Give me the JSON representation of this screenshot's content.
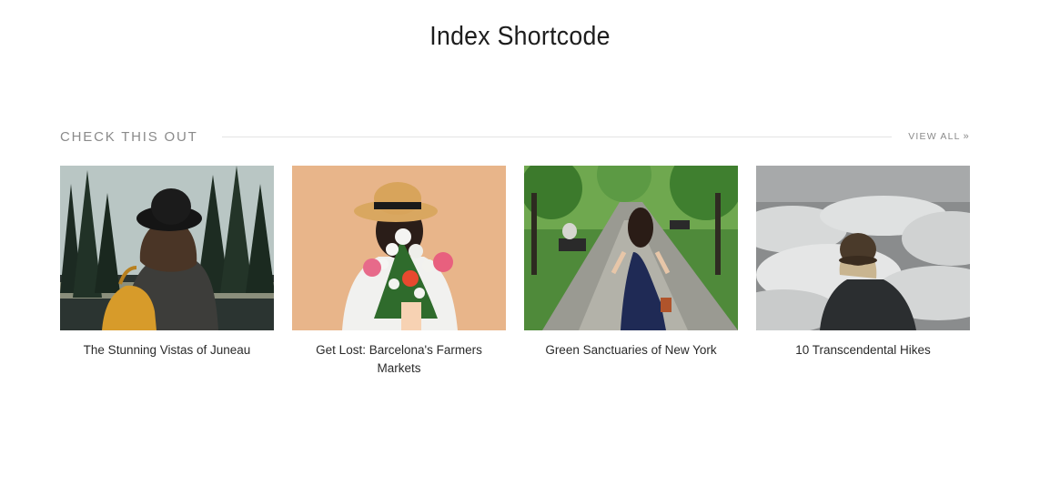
{
  "page": {
    "title": "Index Shortcode"
  },
  "section": {
    "label": "CHECK THIS OUT",
    "view_all_label": "VIEW ALL",
    "view_all_icon": "double-chevron-right-icon"
  },
  "posts": [
    {
      "title": "The Stunning Vistas of Juneau",
      "image": "woman-hat-backpack-forest-lake"
    },
    {
      "title": "Get Lost: Barcelona's Farmers Markets",
      "image": "woman-straw-hat-flower-bouquet"
    },
    {
      "title": "Green Sanctuaries of New York",
      "image": "woman-walking-park-path"
    },
    {
      "title": "10 Transcendental Hikes",
      "image": "hiker-above-clouds"
    }
  ],
  "colors": {
    "text": "#222222",
    "muted": "#8a8a8a",
    "rule": "#e3e3e3",
    "background": "#ffffff"
  }
}
